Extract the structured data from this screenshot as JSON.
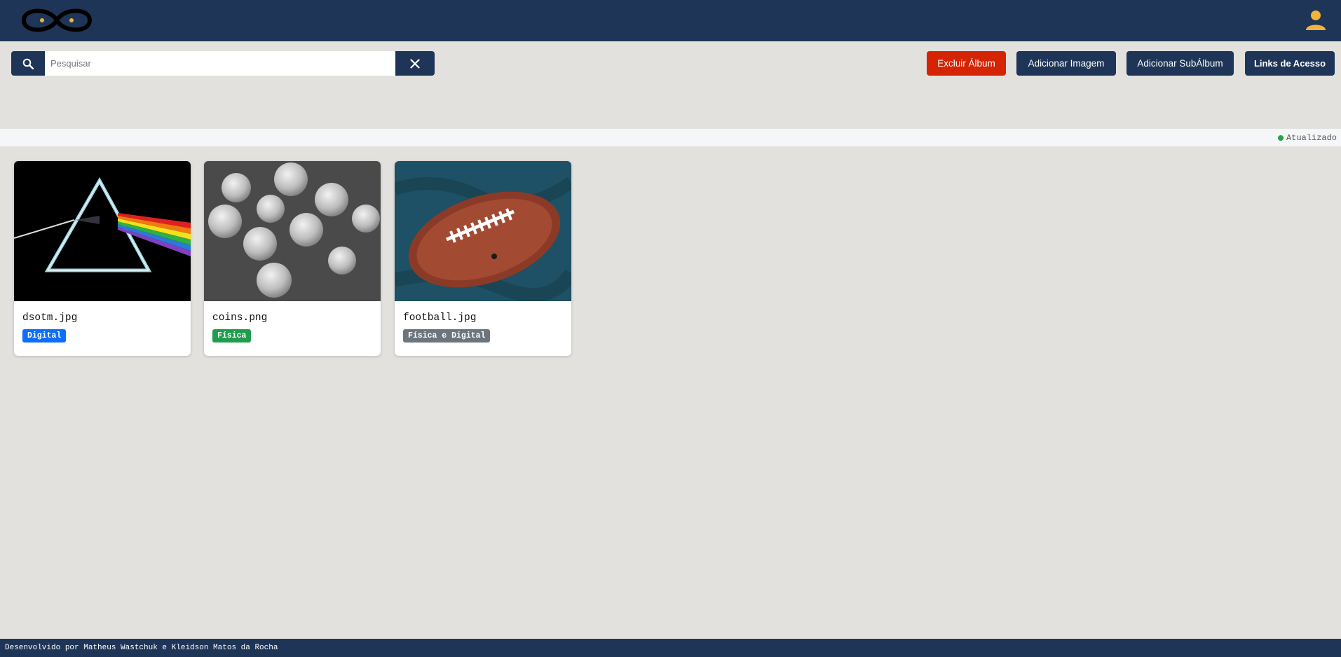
{
  "header": {
    "logo_icon": "infinity-logo-icon",
    "user_icon": "user-icon"
  },
  "search": {
    "placeholder": "Pesquisar",
    "value": "",
    "search_icon": "search-icon",
    "clear_icon": "close-icon"
  },
  "actions": {
    "delete_album": "Excluir Álbum",
    "add_image": "Adicionar Imagem",
    "add_subalbum": "Adicionar SubÁlbum",
    "access_links": "Links de Acesso"
  },
  "status": {
    "text": "Atualizado",
    "color": "#22a447"
  },
  "images": [
    {
      "name": "dsotm.jpg",
      "badge": "Digital",
      "badge_color": "#0d6efd"
    },
    {
      "name": "coins.png",
      "badge": "Física",
      "badge_color": "#1f9d4c"
    },
    {
      "name": "football.jpg",
      "badge": "Física e Digital",
      "badge_color": "#6c757d"
    }
  ],
  "footer": {
    "text": "Desenvolvido por Matheus Wastchuk e Kleidson Matos da Rocha"
  },
  "colors": {
    "navy": "#1f3557",
    "danger": "#d42404",
    "accent": "#f0b43a"
  }
}
